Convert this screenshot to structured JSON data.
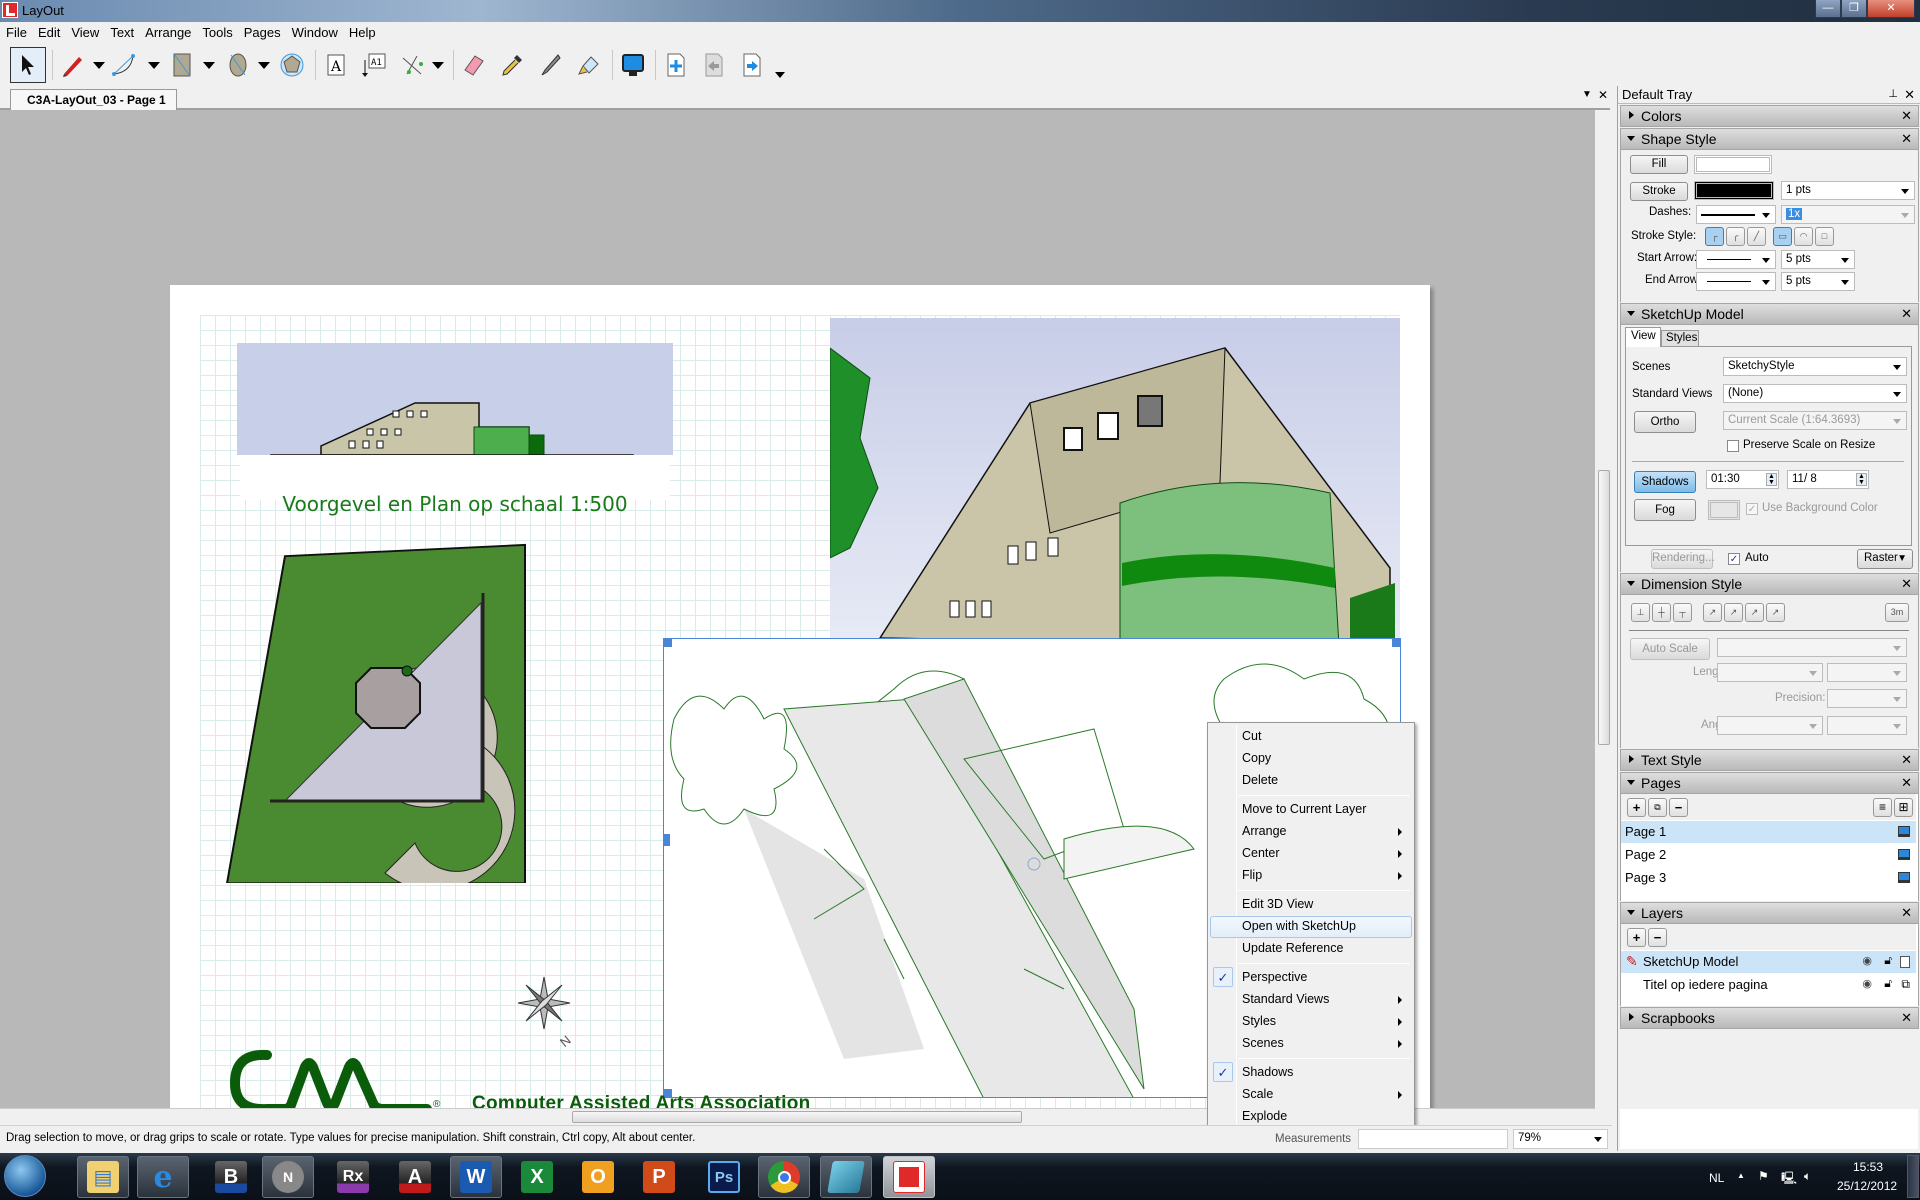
{
  "window": {
    "title": "LayOut",
    "controls": {
      "minimize": "—",
      "restore": "❐",
      "close": "✕"
    }
  },
  "menu": [
    "File",
    "Edit",
    "View",
    "Text",
    "Arrange",
    "Tools",
    "Pages",
    "Window",
    "Help"
  ],
  "toolbar": {
    "tools": [
      "select-tool",
      "line-tool",
      "arc-tool",
      "rectangle-tool",
      "circle-tool",
      "polygon-tool",
      "text-tool",
      "label-tool",
      "dimension-tool",
      "eraser-tool",
      "sample-tool",
      "split-tool",
      "join-tool",
      "presentation-tool",
      "add-page",
      "previous-page",
      "next-page"
    ]
  },
  "document": {
    "tab": "C3A-LayOut_03 - Page 1",
    "elevation_caption": "Voorgevel en Plan op schaal 1:500",
    "logo_text": "Computer Assisted Arts Association",
    "logo_mark": "Cm",
    "registered": "®",
    "compass_label": "N"
  },
  "context_menu": {
    "items": [
      {
        "label": "Cut"
      },
      {
        "label": "Copy"
      },
      {
        "label": "Delete"
      },
      {
        "sep": true
      },
      {
        "label": "Move to Current Layer"
      },
      {
        "label": "Arrange",
        "submenu": true
      },
      {
        "label": "Center",
        "submenu": true
      },
      {
        "label": "Flip",
        "submenu": true
      },
      {
        "sep": true
      },
      {
        "label": "Edit 3D View"
      },
      {
        "label": "Open with SketchUp",
        "hover": true
      },
      {
        "label": "Update Reference"
      },
      {
        "sep": true
      },
      {
        "label": "Perspective",
        "checked": true
      },
      {
        "label": "Standard Views",
        "submenu": true
      },
      {
        "label": "Styles",
        "submenu": true
      },
      {
        "label": "Scenes",
        "submenu": true
      },
      {
        "sep": true
      },
      {
        "label": "Shadows",
        "checked": true
      },
      {
        "label": "Scale",
        "submenu": true
      },
      {
        "label": "Explode"
      }
    ],
    "check_glyph": "✓"
  },
  "status": {
    "message": "Drag selection to move, or drag grips to scale or rotate. Type values for precise manipulation. Shift constrain, Ctrl copy, Alt about center.",
    "measurements_label": "Measurements",
    "measurements_value": "",
    "zoom": "79%"
  },
  "tray": {
    "title": "Default Tray",
    "pin": "⊥",
    "close": "✕",
    "panels": {
      "colors": {
        "title": "Colors"
      },
      "shape_style": {
        "title": "Shape Style",
        "fill_label": "Fill",
        "stroke_label": "Stroke",
        "stroke_width": "1 pts",
        "dashes_label": "Dashes:",
        "dash_scale": "1x",
        "stroke_style_label": "Stroke Style:",
        "start_arrow_label": "Start Arrow:",
        "start_arrow_size": "5 pts",
        "end_arrow_label": "End Arrow:",
        "end_arrow_size": "5 pts",
        "fill_color": "#ffffff",
        "stroke_color": "#000000"
      },
      "sketchup_model": {
        "title": "SketchUp Model",
        "tabs": [
          "View",
          "Styles"
        ],
        "active_tab": "View",
        "scenes_label": "Scenes",
        "scenes_value": "SketchyStyle",
        "standard_views_label": "Standard Views",
        "standard_views_value": "(None)",
        "ortho_label": "Ortho",
        "scale_value": "Current Scale (1:64.3693)",
        "preserve_scale_label": "Preserve Scale on Resize",
        "preserve_scale_checked": false,
        "shadows_label": "Shadows",
        "shadow_time": "01:30",
        "shadow_date": "11/ 8",
        "fog_label": "Fog",
        "use_bg_label": "Use Background Color",
        "use_bg_checked": true,
        "rendering_label": "Rendering...",
        "auto_label": "Auto",
        "auto_checked": true,
        "render_mode": "Raster"
      },
      "dimension_style": {
        "title": "Dimension Style",
        "auto_scale_label": "Auto Scale",
        "length_label": "Length:",
        "precision_label": "Precision:",
        "angle_label": "Angle:",
        "scale_icon_label": "3m"
      },
      "text_style": {
        "title": "Text Style"
      },
      "pages": {
        "title": "Pages",
        "items": [
          {
            "label": "Page 1",
            "selected": true
          },
          {
            "label": "Page 2",
            "selected": false
          },
          {
            "label": "Page 3",
            "selected": false
          }
        ]
      },
      "layers": {
        "title": "Layers",
        "items": [
          {
            "label": "SketchUp Model",
            "selected": true
          },
          {
            "label": "Titel op iedere pagina",
            "selected": false
          }
        ]
      },
      "scrapbooks": {
        "title": "Scrapbooks"
      }
    }
  },
  "taskbar": {
    "apps": [
      "start",
      "explorer",
      "internet-explorer",
      "app-b",
      "app-n",
      "app-rx",
      "app-a",
      "word",
      "excel",
      "outlook",
      "powerpoint",
      "photoshop",
      "chrome",
      "notepad",
      "layout"
    ],
    "labels": {
      "word": "W",
      "excel": "X",
      "outlook": "O",
      "powerpoint": "P",
      "photoshop": "Ps",
      "app-b": "B",
      "app-rx": "Rx",
      "app-a": "A",
      "app-n": "N"
    },
    "language": "NL",
    "time": "15:53",
    "date": "25/12/2012"
  },
  "colors": {
    "brand_green": "#0a5c0a",
    "selection_blue": "#4a86d8",
    "hover_blue": "#cce4f7"
  }
}
